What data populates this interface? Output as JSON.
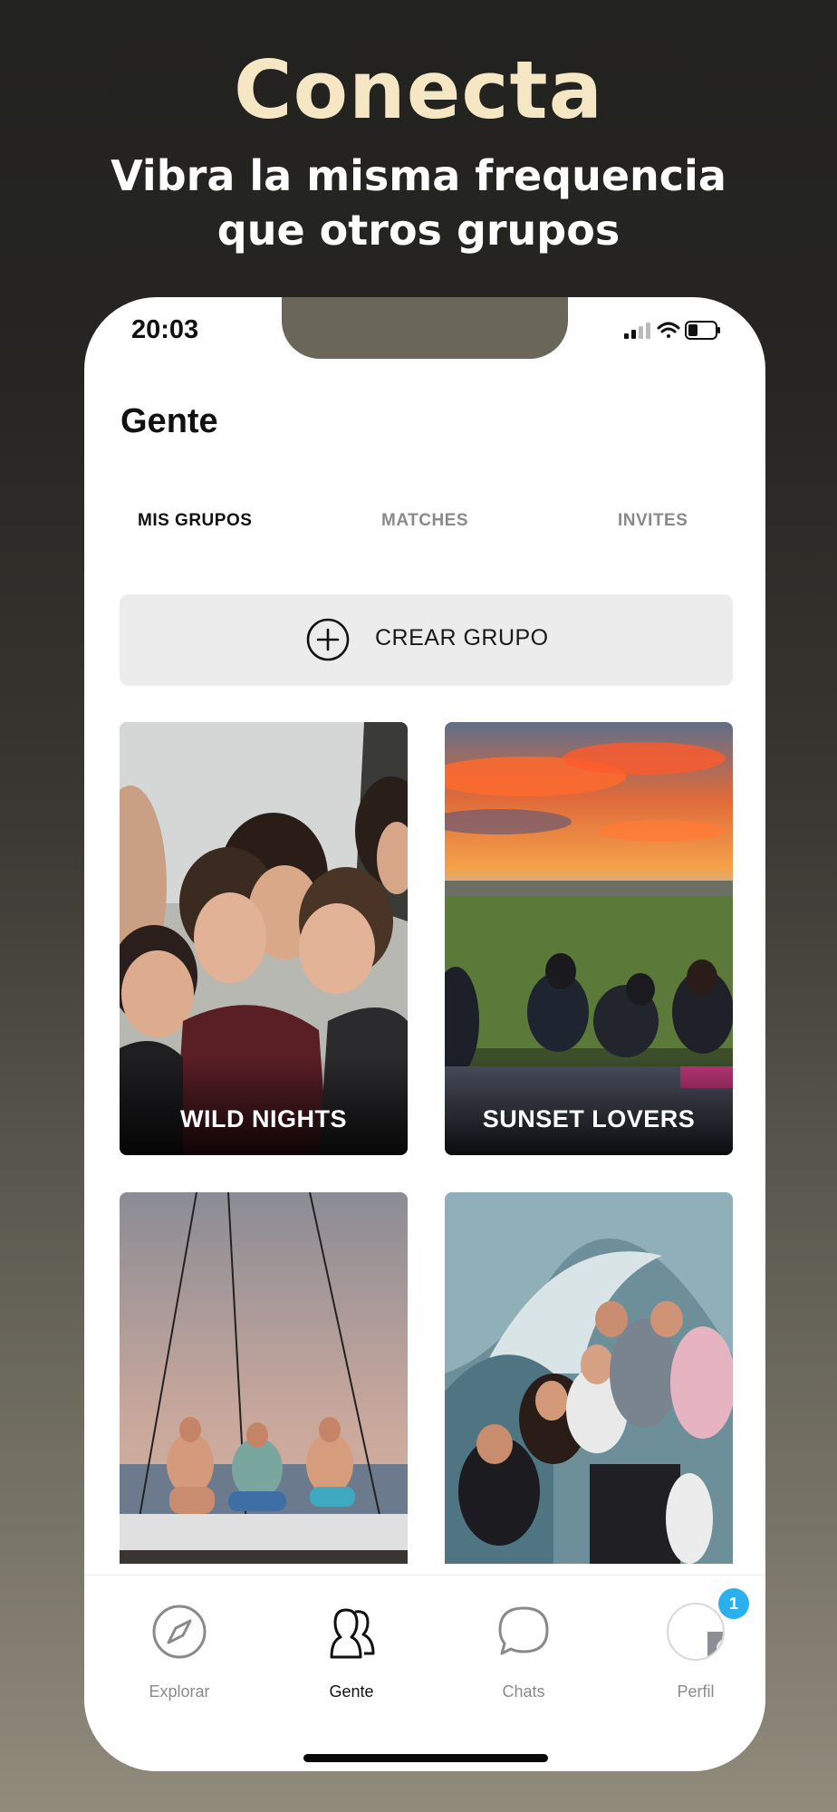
{
  "promo": {
    "headline": "Conecta",
    "subheadline": "Vibra la misma frequencia que otros grupos"
  },
  "status_bar": {
    "time": "20:03",
    "icons": [
      "signal-icon",
      "wifi-icon",
      "battery-icon"
    ]
  },
  "header": {
    "title": "Gente"
  },
  "tabs": [
    {
      "label": "MIS GRUPOS",
      "active": true
    },
    {
      "label": "MATCHES",
      "active": false
    },
    {
      "label": "INVITES",
      "active": false
    }
  ],
  "create_group": {
    "label": "CREAR GRUPO",
    "icon": "plus-circle-icon"
  },
  "groups": [
    {
      "name": "WILD NIGHTS"
    },
    {
      "name": "SUNSET LOVERS"
    },
    {
      "name": ""
    },
    {
      "name": ""
    }
  ],
  "tabbar": {
    "items": [
      {
        "label": "Explorar",
        "icon": "compass-icon",
        "active": false
      },
      {
        "label": "Gente",
        "icon": "people-icon",
        "active": true
      },
      {
        "label": "Chats",
        "icon": "chat-bubble-icon",
        "active": false
      },
      {
        "label": "Perfil",
        "icon": "avatar",
        "active": false,
        "badge": "1"
      }
    ]
  },
  "colors": {
    "headline": "#f5e6c4",
    "badge": "#2bb0ef",
    "button_bg": "#ececec"
  }
}
